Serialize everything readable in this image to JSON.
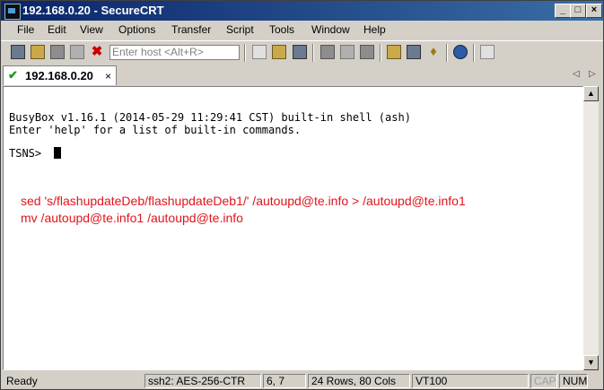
{
  "window": {
    "title": "192.168.0.20 - SecureCRT"
  },
  "menu": [
    "File",
    "Edit",
    "View",
    "Options",
    "Transfer",
    "Script",
    "Tools",
    "Window",
    "Help"
  ],
  "toolbar": {
    "host_placeholder": "Enter host <Alt+R>"
  },
  "tab": {
    "label": "192.168.0.20",
    "close": "×"
  },
  "terminal": {
    "line1": "BusyBox v1.16.1 (2014-05-29 11:29:41 CST) built-in shell (ash)",
    "line2": "Enter 'help' for a list of built-in commands.",
    "prompt": "TSNS> "
  },
  "annotation": [
    "sed 's/flashupdateDeb/flashupdateDeb1/' /autoupd@te.info > /autoupd@te.info1",
    "mv /autoupd@te.info1 /autoupd@te.info"
  ],
  "status": {
    "ready": "Ready",
    "cipher": "ssh2: AES-256-CTR",
    "cursor_pos": "6,   7",
    "size": "24 Rows, 80 Cols",
    "emulation": "VT100",
    "caps": "CAP",
    "num": "NUM"
  },
  "colors": {
    "annotation": "#e0141c",
    "titlebar": "#0a246a"
  },
  "icons": [
    "connect-icon",
    "quick-connect-icon",
    "connect-tab-icon",
    "reconnect-icon",
    "disconnect-icon",
    "copy-icon",
    "paste-icon",
    "find-icon",
    "print-setup-icon",
    "print-icon",
    "sftp-icon",
    "session-options-icon",
    "global-options-icon",
    "keymap-icon",
    "help-icon",
    "log-icon"
  ]
}
